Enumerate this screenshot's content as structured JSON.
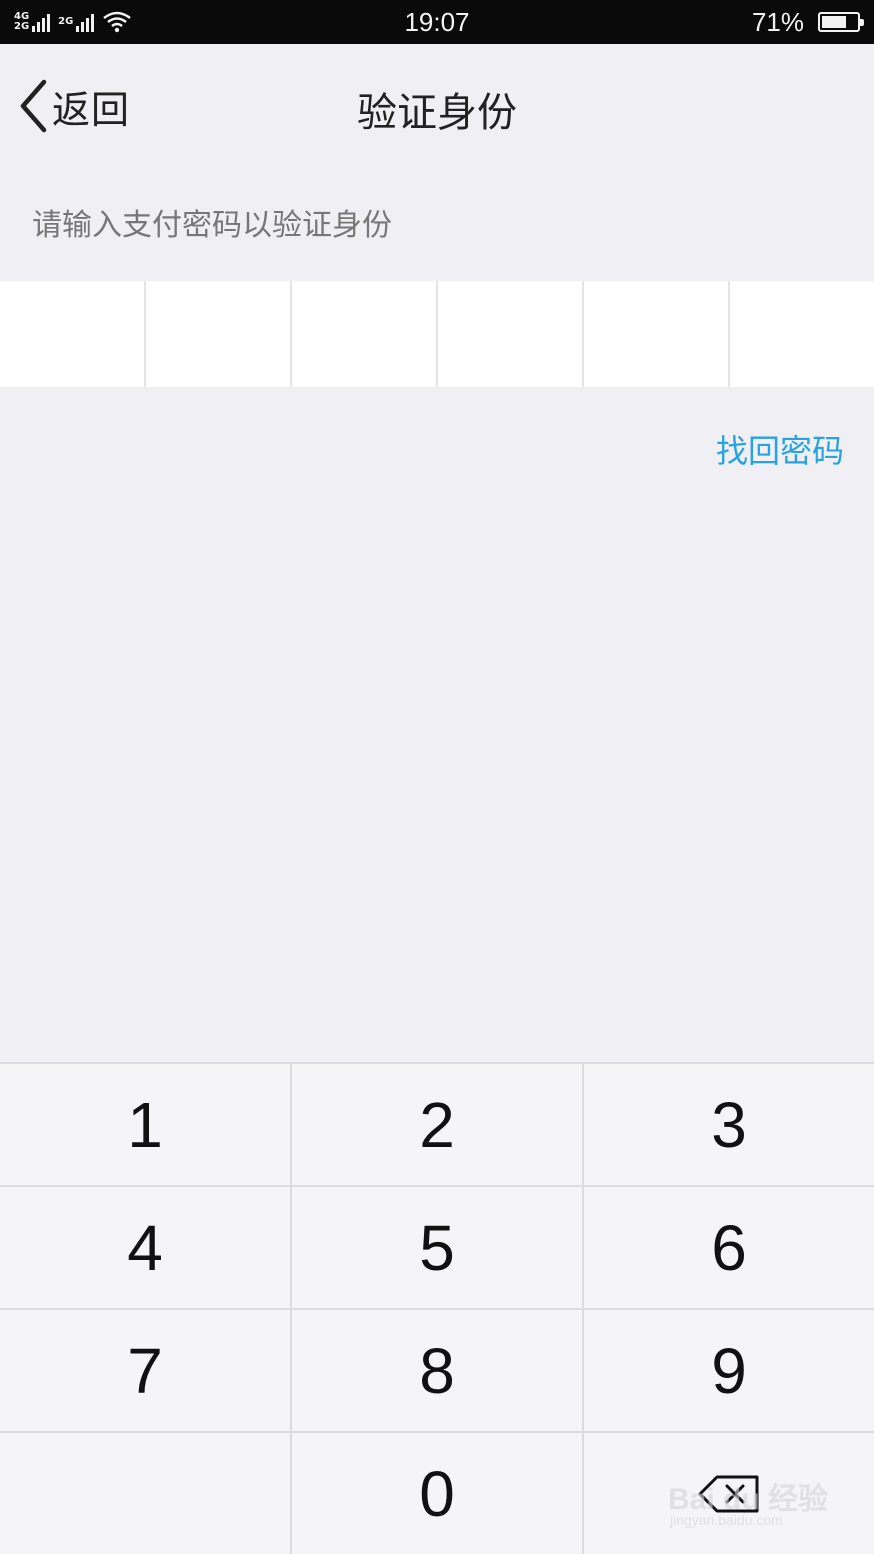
{
  "status_bar": {
    "network1_top": "4G",
    "network1_bottom": "2G",
    "network2": "2G",
    "time": "19:07",
    "battery_text": "71%",
    "battery_level": 0.71
  },
  "nav": {
    "back_label": "返回",
    "title": "验证身份"
  },
  "prompt": "请输入支付密码以验证身份",
  "password": {
    "length": 6,
    "entered": 0
  },
  "forgot_label": "找回密码",
  "keypad": {
    "k1": "1",
    "k2": "2",
    "k3": "3",
    "k4": "4",
    "k5": "5",
    "k6": "6",
    "k7": "7",
    "k8": "8",
    "k9": "9",
    "k0": "0"
  },
  "watermark": {
    "text": "Bai du 经验",
    "sub": "jingyan.baidu.com"
  },
  "colors": {
    "accent": "#29a3e0",
    "background": "#efeff4",
    "status_bar": "#0a0a0a"
  }
}
